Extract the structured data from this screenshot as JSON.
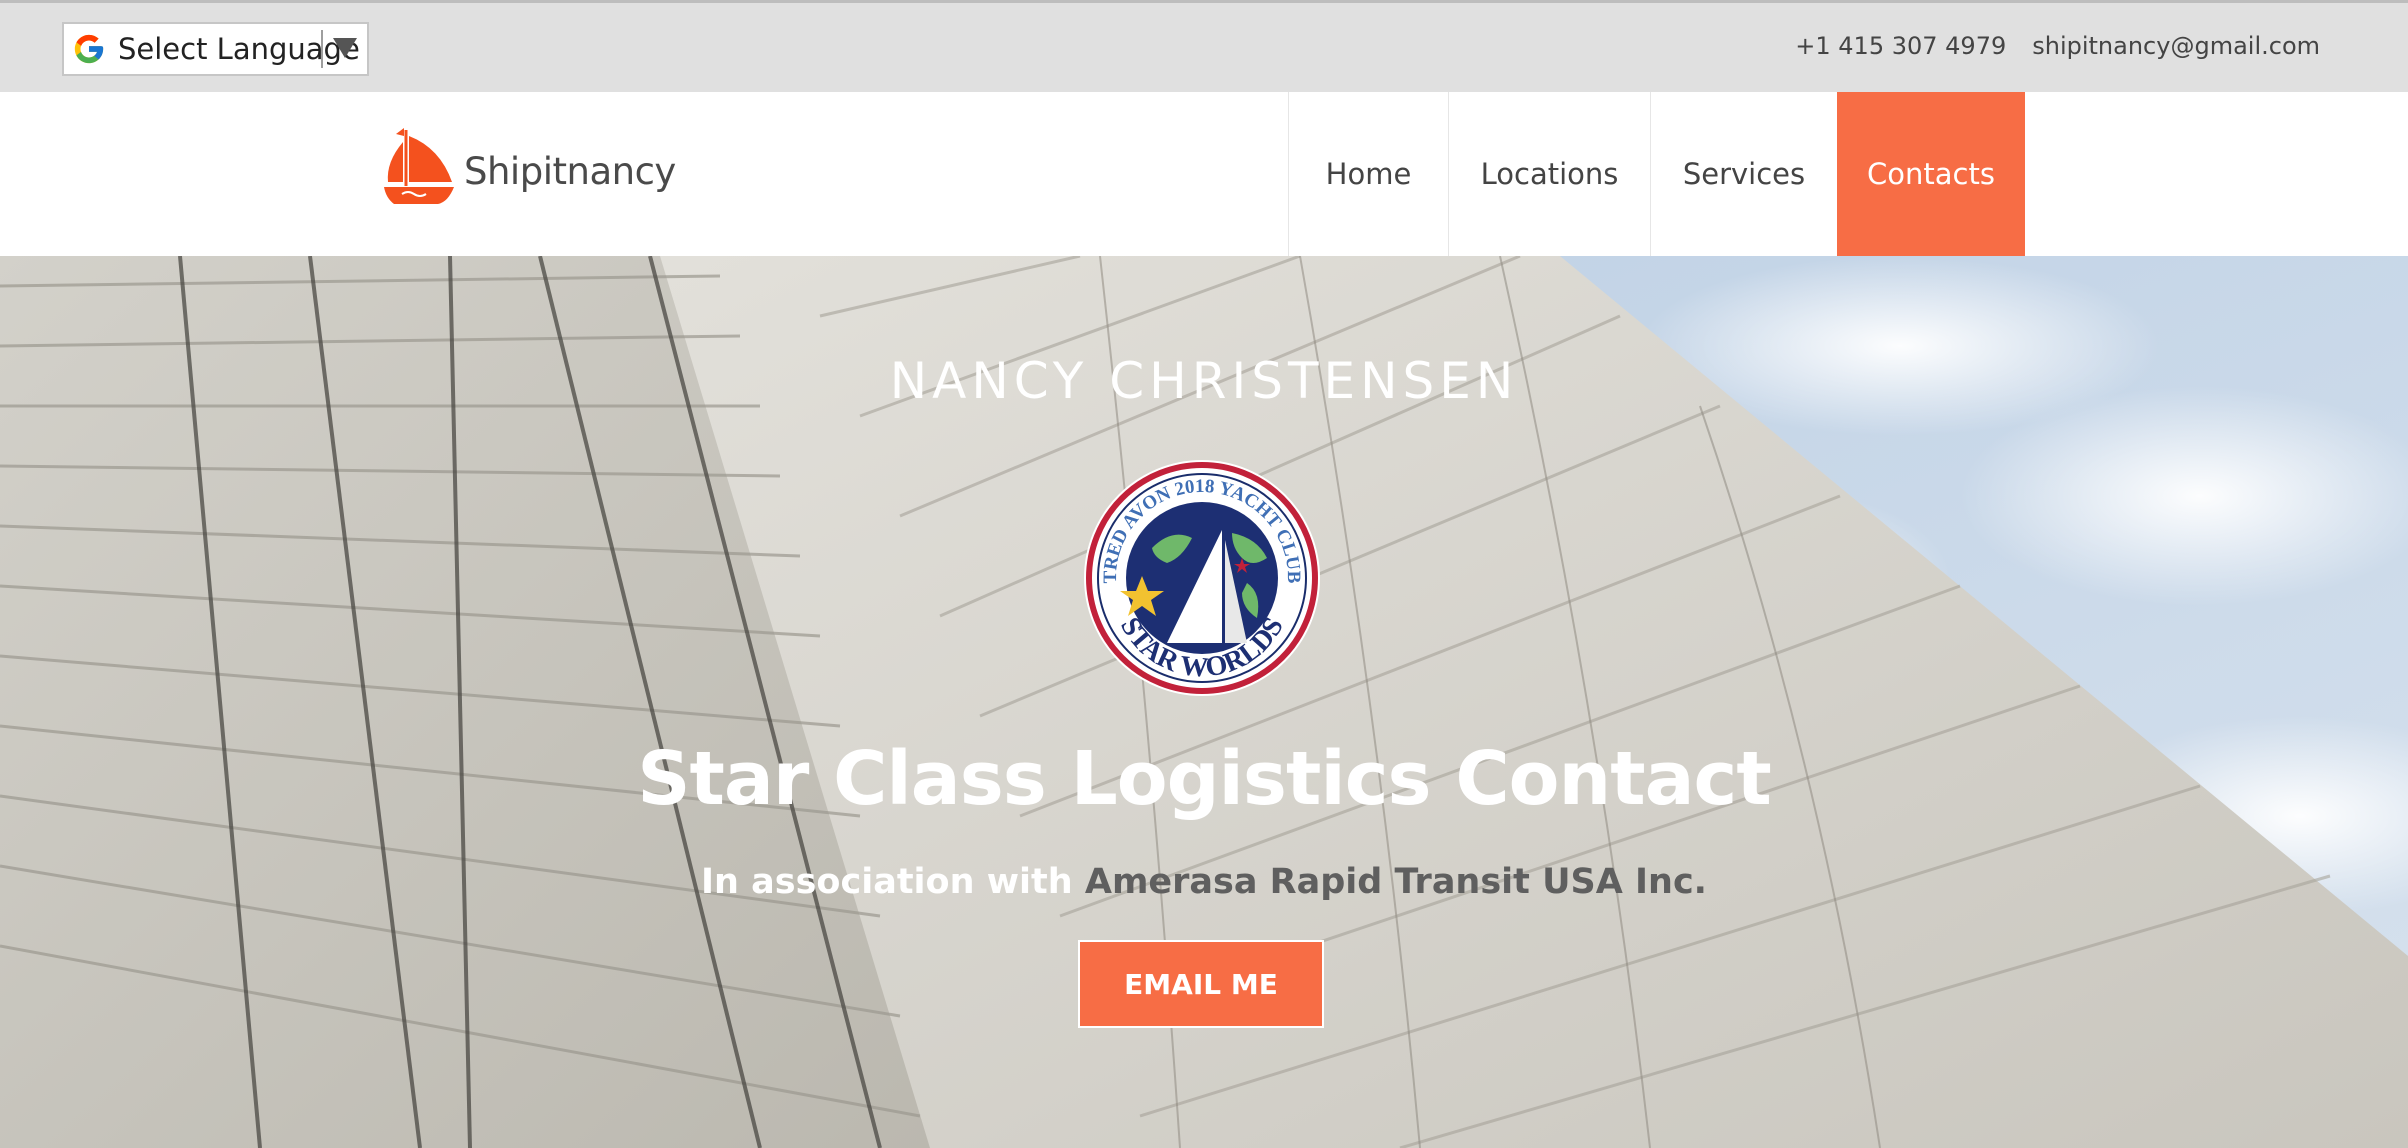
{
  "colors": {
    "accent": "#f76d45",
    "topbar_bg": "#e0e0e0"
  },
  "topbar": {
    "language_label": "Select Language",
    "phone": "+1 415 307 4979",
    "email": "shipitnancy@gmail.com"
  },
  "header": {
    "brand_name": "Shipitnancy",
    "nav": [
      {
        "label": "Home",
        "active": false
      },
      {
        "label": "Locations",
        "active": false
      },
      {
        "label": "Services",
        "active": false
      },
      {
        "label": "Contacts",
        "active": true
      }
    ]
  },
  "hero": {
    "name": "NANCY CHRISTENSEN",
    "badge": {
      "icon": "star-worlds-yacht-club-logo",
      "text_top": "TRED AVON 2018 YACHT CLUB",
      "text_bottom": "STAR WORLDS"
    },
    "title": "Star Class Logistics Contact",
    "subtitle_prefix": "In association with",
    "subtitle_company": "Amerasa Rapid Transit USA Inc.",
    "cta_label": "EMAIL ME"
  }
}
